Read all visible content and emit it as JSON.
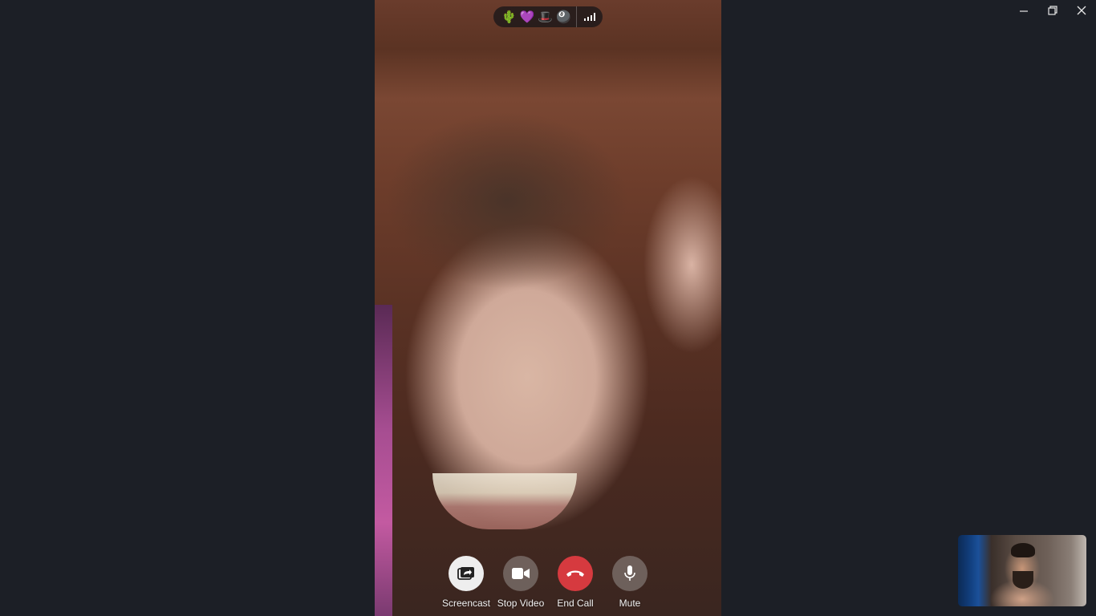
{
  "window": {
    "controls": [
      {
        "name": "minimize",
        "icon": "minimize-icon"
      },
      {
        "name": "restore",
        "icon": "restore-icon"
      },
      {
        "name": "close",
        "icon": "close-icon"
      }
    ]
  },
  "status_bar": {
    "emoji_key": [
      "🌵",
      "💜",
      "🎩",
      "🎱"
    ],
    "signal_icon": "signal-bars-icon"
  },
  "controls": {
    "screencast": {
      "label": "Screencast",
      "icon": "screencast-icon"
    },
    "stop_video": {
      "label": "Stop Video",
      "icon": "video-camera-icon"
    },
    "end_call": {
      "label": "End Call",
      "icon": "phone-hangup-icon"
    },
    "mute": {
      "label": "Mute",
      "icon": "microphone-icon"
    }
  },
  "colors": {
    "background": "#1c1f26",
    "end_call": "#d63a3f"
  }
}
